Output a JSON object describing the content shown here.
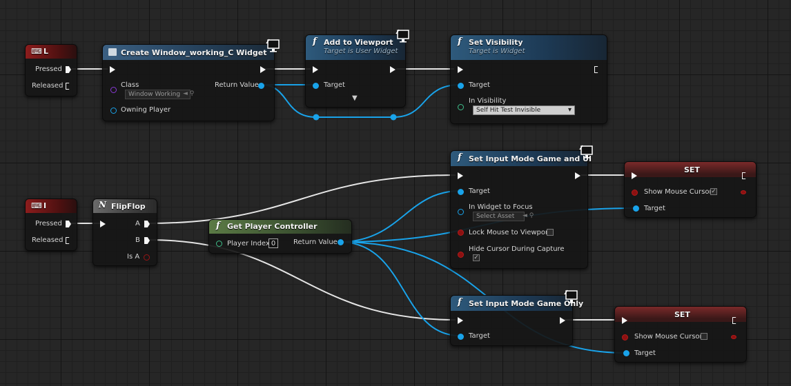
{
  "nodes": {
    "event_l": {
      "key": "L",
      "pressed": "Pressed",
      "released": "Released"
    },
    "create_widget": {
      "title": "Create Window_working_C Widget",
      "class_label": "Class",
      "class_value": "Window Working",
      "return_value": "Return Value",
      "owning_player": "Owning Player"
    },
    "add_to_viewport": {
      "title": "Add to Viewport",
      "subtitle": "Target is User Widget",
      "target": "Target"
    },
    "set_visibility": {
      "title": "Set Visibility",
      "subtitle": "Target is Widget",
      "target": "Target",
      "in_visibility": "In Visibility",
      "visibility_value": "Self Hit Test Invisible"
    },
    "event_i": {
      "key": "I",
      "pressed": "Pressed",
      "released": "Released"
    },
    "flipflop": {
      "title": "FlipFlop",
      "a": "A",
      "b": "B",
      "is_a": "Is A"
    },
    "get_player_controller": {
      "title": "Get Player Controller",
      "player_index": "Player Index",
      "player_index_value": "0",
      "return_value": "Return Value"
    },
    "set_input_game_ui": {
      "title": "Set Input Mode Game and UI",
      "target": "Target",
      "in_widget_to_focus": "In Widget to Focus",
      "select_asset": "Select Asset",
      "lock_mouse": "Lock Mouse to Viewport",
      "hide_cursor": "Hide Cursor During Capture"
    },
    "set_1": {
      "title": "SET",
      "show_mouse_cursor": "Show Mouse Cursor",
      "target": "Target"
    },
    "set_input_game_only": {
      "title": "Set Input Mode Game Only",
      "target": "Target"
    },
    "set_2": {
      "title": "SET",
      "show_mouse_cursor": "Show Mouse Cursor",
      "target": "Target"
    }
  },
  "colors": {
    "exec": "#f5f5f5",
    "object_pin": "#19a3ea",
    "bool_pin": "#9b1515"
  }
}
